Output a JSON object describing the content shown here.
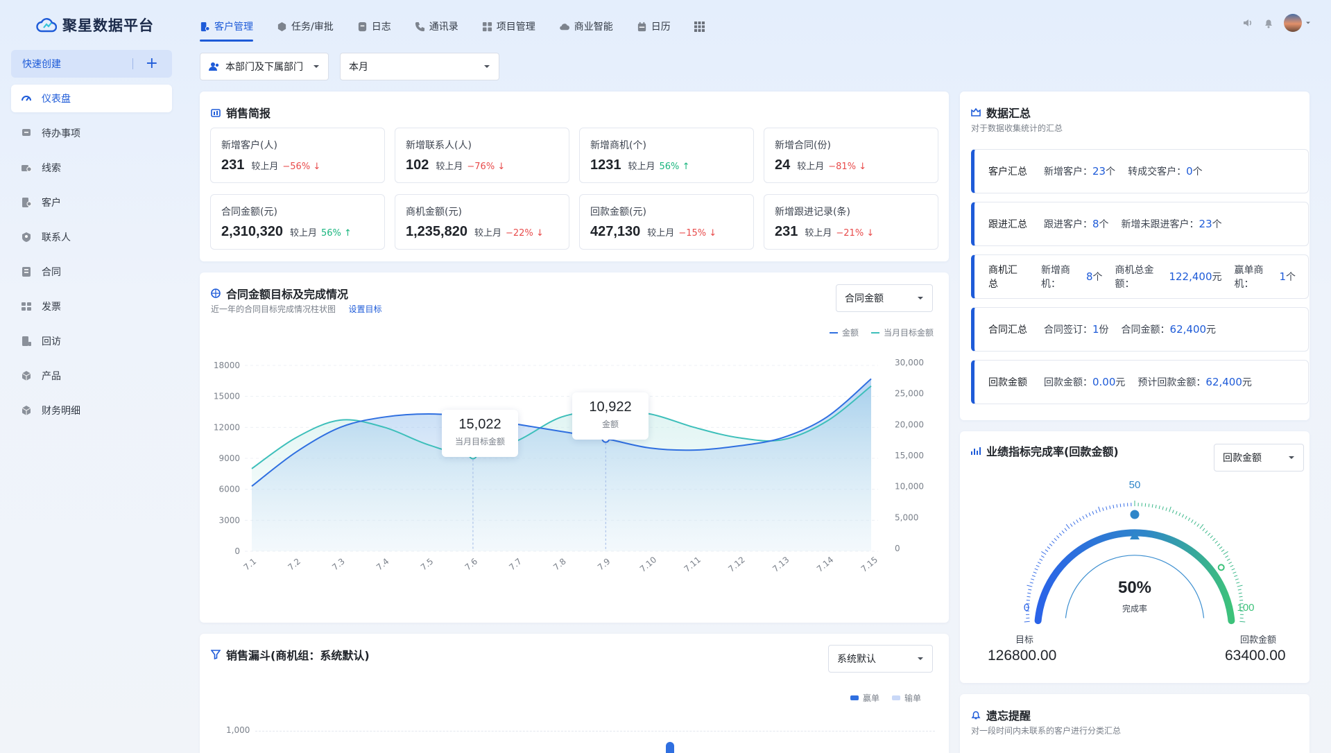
{
  "brand": {
    "name": "聚星数据平台",
    "accent": "#1e5bd8"
  },
  "sidebar": {
    "quick_create": "快速创建",
    "items": [
      {
        "label": "仪表盘",
        "icon": "dashboard-icon",
        "active": true
      },
      {
        "label": "待办事项",
        "icon": "todo-icon"
      },
      {
        "label": "线索",
        "icon": "lead-icon"
      },
      {
        "label": "客户",
        "icon": "customer-icon"
      },
      {
        "label": "联系人",
        "icon": "contact-icon"
      },
      {
        "label": "合同",
        "icon": "contract-icon"
      },
      {
        "label": "发票",
        "icon": "invoice-icon"
      },
      {
        "label": "回访",
        "icon": "revisit-icon"
      },
      {
        "label": "产品",
        "icon": "product-icon"
      },
      {
        "label": "财务明细",
        "icon": "finance-icon"
      }
    ]
  },
  "topmenu": [
    {
      "label": "客户管理",
      "icon": "customer-manage-icon",
      "active": true
    },
    {
      "label": "任务/审批",
      "icon": "task-icon"
    },
    {
      "label": "日志",
      "icon": "log-icon"
    },
    {
      "label": "通讯录",
      "icon": "phone-icon"
    },
    {
      "label": "项目管理",
      "icon": "project-icon"
    },
    {
      "label": "商业智能",
      "icon": "cloud-icon"
    },
    {
      "label": "日历",
      "icon": "calendar-icon"
    }
  ],
  "filters": {
    "dept": "本部门及下属部门",
    "period": "本月"
  },
  "sales_brief": {
    "title": "销售简报",
    "stats": [
      {
        "label": "新增客户(人)",
        "value": "231",
        "cmp": "较上月",
        "pct": "−56%",
        "dir": "down"
      },
      {
        "label": "新增联系人(人)",
        "value": "102",
        "cmp": "较上月",
        "pct": "−76%",
        "dir": "down"
      },
      {
        "label": "新增商机(个)",
        "value": "1231",
        "cmp": "较上月",
        "pct": "56%",
        "dir": "up"
      },
      {
        "label": "新增合同(份)",
        "value": "24",
        "cmp": "较上月",
        "pct": "−81%",
        "dir": "down"
      },
      {
        "label": "合同金额(元)",
        "value": "2,310,320",
        "cmp": "较上月",
        "pct": "56%",
        "dir": "up"
      },
      {
        "label": "商机金额(元)",
        "value": "1,235,820",
        "cmp": "较上月",
        "pct": "−22%",
        "dir": "down"
      },
      {
        "label": "回款金额(元)",
        "value": "427,130",
        "cmp": "较上月",
        "pct": "−15%",
        "dir": "down"
      },
      {
        "label": "新增跟进记录(条)",
        "value": "231",
        "cmp": "较上月",
        "pct": "−21%",
        "dir": "down"
      }
    ]
  },
  "summary": {
    "title": "数据汇总",
    "subtitle": "对于数据收集统计的汇总",
    "rows": [
      {
        "name": "客户汇总",
        "items": [
          {
            "k": "新增客户：",
            "v": "23",
            "u": "个"
          },
          {
            "k": "转成交客户：",
            "v": "0",
            "u": "个"
          }
        ]
      },
      {
        "name": "跟进汇总",
        "items": [
          {
            "k": "跟进客户：",
            "v": "8",
            "u": "个"
          },
          {
            "k": "新增未跟进客户：",
            "v": "23",
            "u": "个"
          }
        ]
      },
      {
        "name": "商机汇总",
        "items": [
          {
            "k": "新增商机：",
            "v": "8",
            "u": "个"
          },
          {
            "k": "商机总金额：",
            "v": "122,400",
            "u": "元"
          },
          {
            "k": "赢单商机：",
            "v": "1",
            "u": "个"
          }
        ]
      },
      {
        "name": "合同汇总",
        "items": [
          {
            "k": "合同签订：",
            "v": "1",
            "u": "份"
          },
          {
            "k": "合同金额：",
            "v": "62,400",
            "u": "元"
          }
        ]
      },
      {
        "name": "回款金额",
        "items": [
          {
            "k": "回款金额：",
            "v": "0.00",
            "u": "元"
          },
          {
            "k": "预计回款金额：",
            "v": "62,400",
            "u": "元"
          }
        ]
      }
    ]
  },
  "target_chart": {
    "title": "合同金额目标及完成情况",
    "subtitle": "近一年的合同目标完成情况柱状图",
    "set_target": "设置目标",
    "select": "合同金额",
    "tooltip1": {
      "value": "15,022",
      "label": "当月目标金额"
    },
    "tooltip2": {
      "value": "10,922",
      "label": "金额"
    }
  },
  "chart_data": {
    "type": "line",
    "x": [
      "7.1",
      "7.2",
      "7.3",
      "7.4",
      "7.5",
      "7.6",
      "7.7",
      "7.8",
      "7.9",
      "7.10",
      "7.11",
      "7.12",
      "7.13",
      "7.14",
      "7.15"
    ],
    "left_ticks": [
      "18000",
      "15000",
      "12000",
      "9000",
      "6000",
      "3000",
      "0"
    ],
    "right_ticks": [
      "30,000",
      "25,000",
      "20,000",
      "15,000",
      "10,000",
      "5,000",
      "0"
    ],
    "ylim_left": [
      0,
      18000
    ],
    "ylim_right": [
      0,
      30000
    ],
    "series": [
      {
        "name": "金额",
        "color": "#2f6fe0",
        "axis": "left",
        "values": [
          6300,
          9600,
          12000,
          13000,
          13300,
          13000,
          12300,
          11600,
          10900,
          10000,
          9800,
          10200,
          11000,
          13000,
          16700
        ]
      },
      {
        "name": "当月目标金额",
        "color": "#3dbfba",
        "axis": "left",
        "values": [
          8000,
          11000,
          12700,
          12000,
          10300,
          9300,
          10700,
          13000,
          13600,
          13300,
          12000,
          11000,
          10800,
          12600,
          16000
        ]
      }
    ]
  },
  "funnel": {
    "title": "销售漏斗(商机组：系统默认)",
    "select": "系统默认",
    "legend_win": "赢单",
    "legend_lose": "输单",
    "tick": "1,000"
  },
  "gauge": {
    "title": "业绩指标完成率(回款金额)",
    "select": "回款金额",
    "min": "0",
    "mid": "50",
    "max": "100",
    "percent": "50%",
    "percent_value": 50,
    "rate_label": "完成率",
    "target_label": "目标",
    "target_value": "126800.00",
    "collected_label": "回款金额",
    "collected_value": "63400.00"
  },
  "reminder": {
    "title": "遗忘提醒",
    "subtitle": "对一段时间内未联系的客户进行分类汇总"
  }
}
